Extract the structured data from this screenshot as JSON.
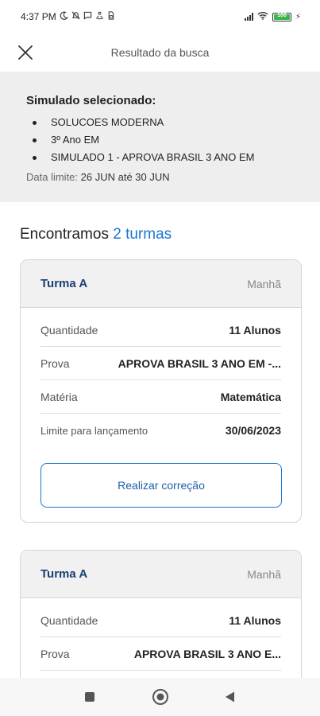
{
  "status_bar": {
    "time": "4:37 PM",
    "notification_icons": [
      "moon-icon",
      "muted-icon",
      "message-icon",
      "transfer-icon",
      "sim-icon"
    ],
    "battery_level": "100"
  },
  "app_bar": {
    "title": "Resultado da busca",
    "close_icon": "close-icon"
  },
  "selection": {
    "heading": "Simulado selecionado:",
    "items": [
      "SOLUCOES MODERNA",
      "3º Ano EM",
      "SIMULADO 1 - APROVA BRASIL   3 ANO EM"
    ],
    "date_prefix": "Data limite:",
    "date_range": "26 JUN até 30 JUN"
  },
  "results": {
    "prefix": "Encontramos",
    "count_text": "2 turmas"
  },
  "cards": [
    {
      "turma": "Turma A",
      "turno": "Manhã",
      "rows": [
        {
          "label": "Quantidade",
          "value": "11 Alunos"
        },
        {
          "label": "Prova",
          "value": "APROVA BRASIL  3 ANO EM -..."
        },
        {
          "label": "Matéria",
          "value": "Matemática"
        },
        {
          "label": "Limite para lançamento",
          "value": "30/06/2023"
        }
      ],
      "button_label": "Realizar correção"
    },
    {
      "turma": "Turma A",
      "turno": "Manhã",
      "rows": [
        {
          "label": "Quantidade",
          "value": "11 Alunos"
        },
        {
          "label": "Prova",
          "value": "APROVA BRASIL  3 ANO E..."
        }
      ]
    }
  ],
  "nav_bar": {
    "icons": [
      "recents-square-icon",
      "home-circle-icon",
      "back-triangle-icon"
    ]
  },
  "colors": {
    "accent": "#1976d2",
    "turma_title": "#1c3f74",
    "panel_bg": "#eeeeee",
    "battery": "#3ab54a"
  }
}
